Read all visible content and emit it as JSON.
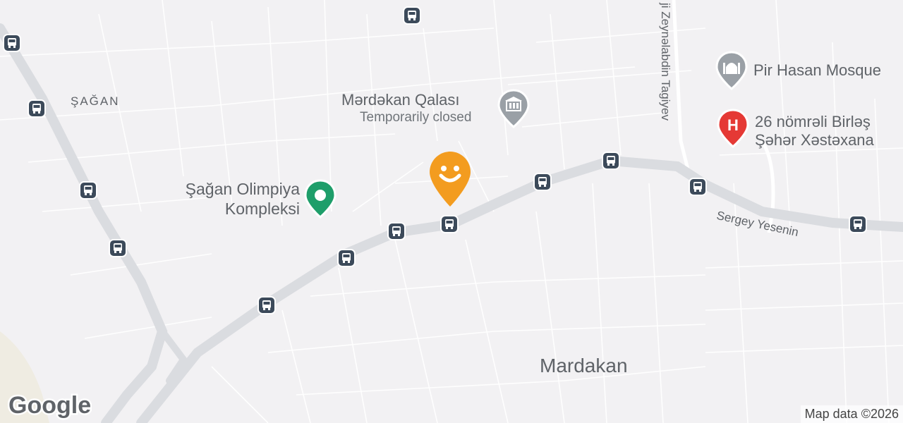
{
  "map": {
    "area_label": "ŞAĞAN",
    "town_label": "Mardakan",
    "street_yesenin": "Sergey Yesenin",
    "street_tagiyev": "Hacı Zeynalabdin Tagiyev",
    "street_tagiyev_visible": "ji Zeynəlabdin Tagiyev",
    "attribution": "Map data ©2026",
    "logo": "Google",
    "colors": {
      "background": "#f2f1f3",
      "road_major": "#dadce0",
      "poi_museum": "#9aa0a6",
      "poi_park": "#1e9e6a",
      "poi_hospital": "#e53935",
      "poi_mosque": "#9aa0a6",
      "marker": "#f39c1f",
      "bus_icon": "#3c4a5a"
    }
  },
  "pois": {
    "mosque": {
      "name": "Pir Hasan Mosque",
      "icon": "mosque-icon"
    },
    "hospital": {
      "line1": "26 nömrəli Birləş",
      "line2": "Şəhər Xəstəxana",
      "icon": "hospital-icon"
    },
    "museum": {
      "name": "Mərdəkan Qalası",
      "status": "Temporarily closed",
      "icon": "museum-icon"
    },
    "park": {
      "line1": "Şağan Olimpiya",
      "line2": "Kompleksi",
      "icon": "park-icon"
    }
  },
  "marker": {
    "icon": "smiley-icon"
  },
  "bus_stops_icon": "bus-icon"
}
